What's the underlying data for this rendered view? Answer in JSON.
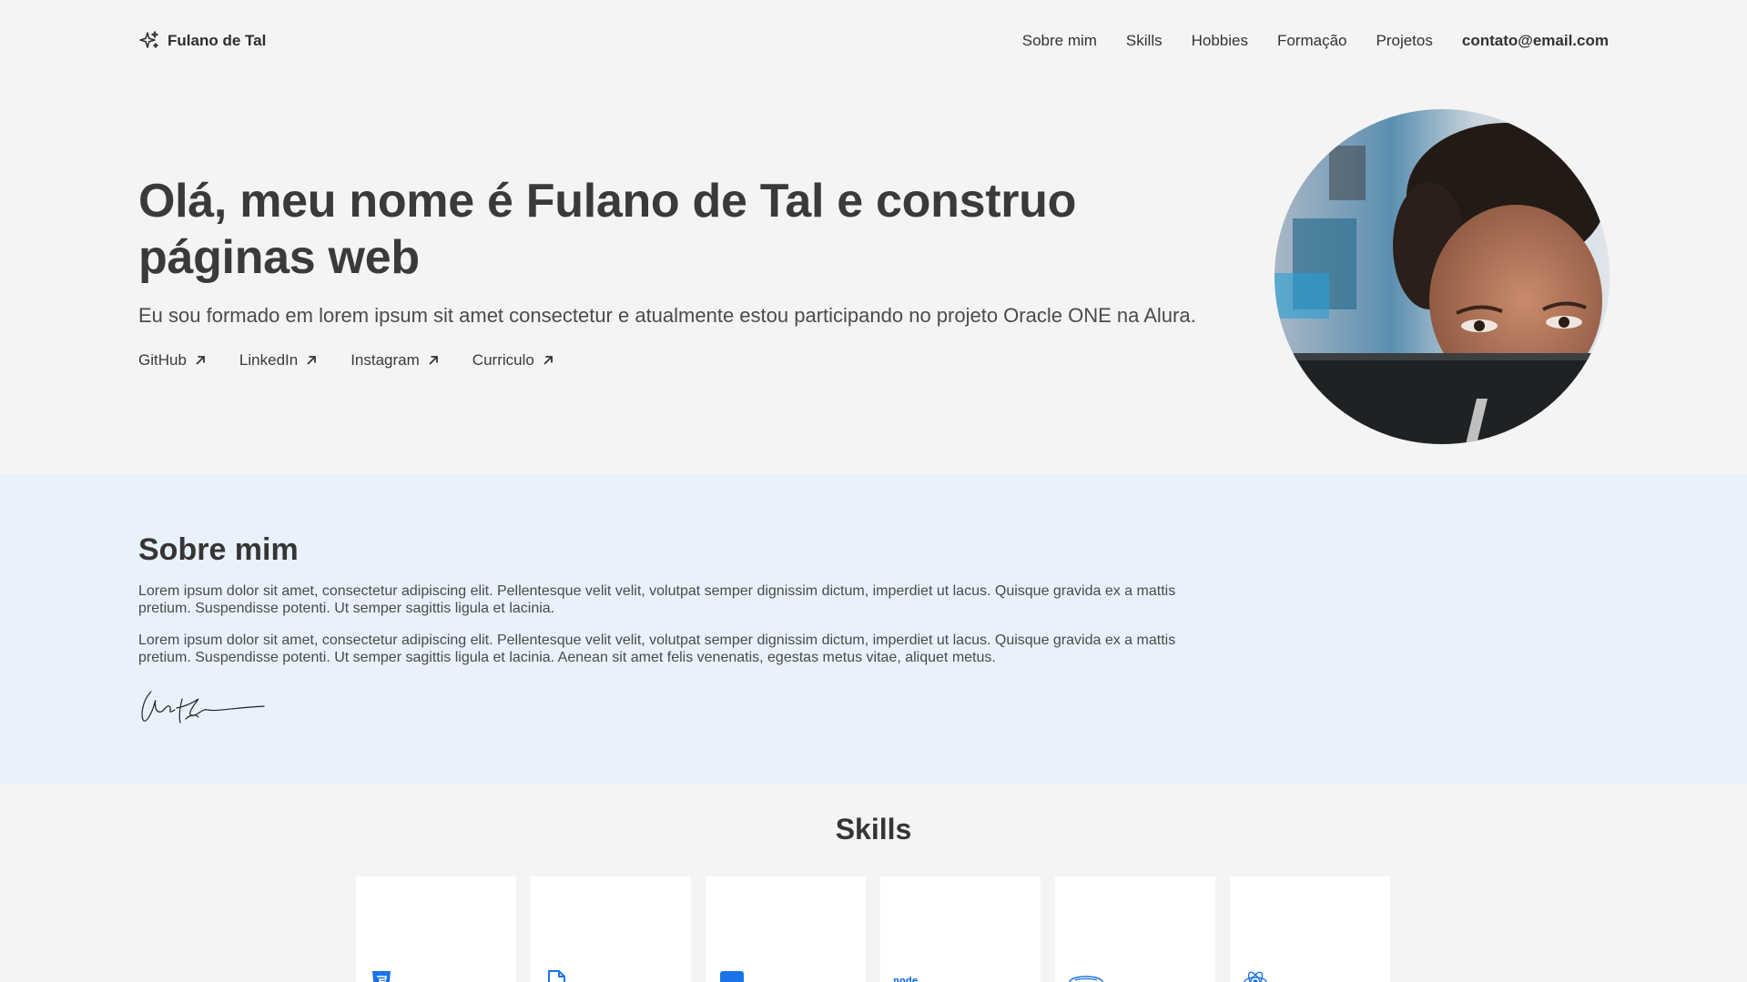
{
  "brand": {
    "name": "Fulano de Tal",
    "icon": "sparkles-icon"
  },
  "nav": {
    "items": [
      "Sobre mim",
      "Skills",
      "Hobbies",
      "Formação",
      "Projetos"
    ],
    "contact": "contato@email.com"
  },
  "hero": {
    "title": "Olá, meu nome é Fulano de Tal e construo páginas web",
    "subtitle": "Eu sou formado em lorem ipsum sit amet consectetur e atualmente estou participando no projeto Oracle ONE na Alura.",
    "links": [
      "GitHub",
      "LinkedIn",
      "Instagram",
      "Curriculo"
    ]
  },
  "about": {
    "title": "Sobre mim",
    "paragraphs": [
      "Lorem ipsum dolor sit amet, consectetur adipiscing elit. Pellentesque velit velit, volutpat semper dignissim dictum, imperdiet ut lacus. Quisque gravida ex a mattis pretium. Suspendisse potenti. Ut semper sagittis ligula et lacinia.",
      "Lorem ipsum dolor sit amet, consectetur adipiscing elit. Pellentesque velit velit, volutpat semper dignissim dictum, imperdiet ut lacus. Quisque gravida ex a mattis pretium. Suspendisse potenti. Ut semper sagittis ligula et lacinia. Aenean sit amet felis venenatis, egestas metus vitae, aliquet metus."
    ]
  },
  "skills": {
    "title": "Skills",
    "cards": [
      {
        "icon": "html5-icon"
      },
      {
        "icon": "css-file-icon"
      },
      {
        "icon": "javascript-square-icon"
      },
      {
        "icon": "node-logo-icon"
      },
      {
        "icon": "database-icon"
      },
      {
        "icon": "react-atom-icon"
      }
    ]
  },
  "colors": {
    "accent": "#1a73e8",
    "about_bg": "#e9f1fc",
    "page_bg": "#f4f4f4"
  }
}
